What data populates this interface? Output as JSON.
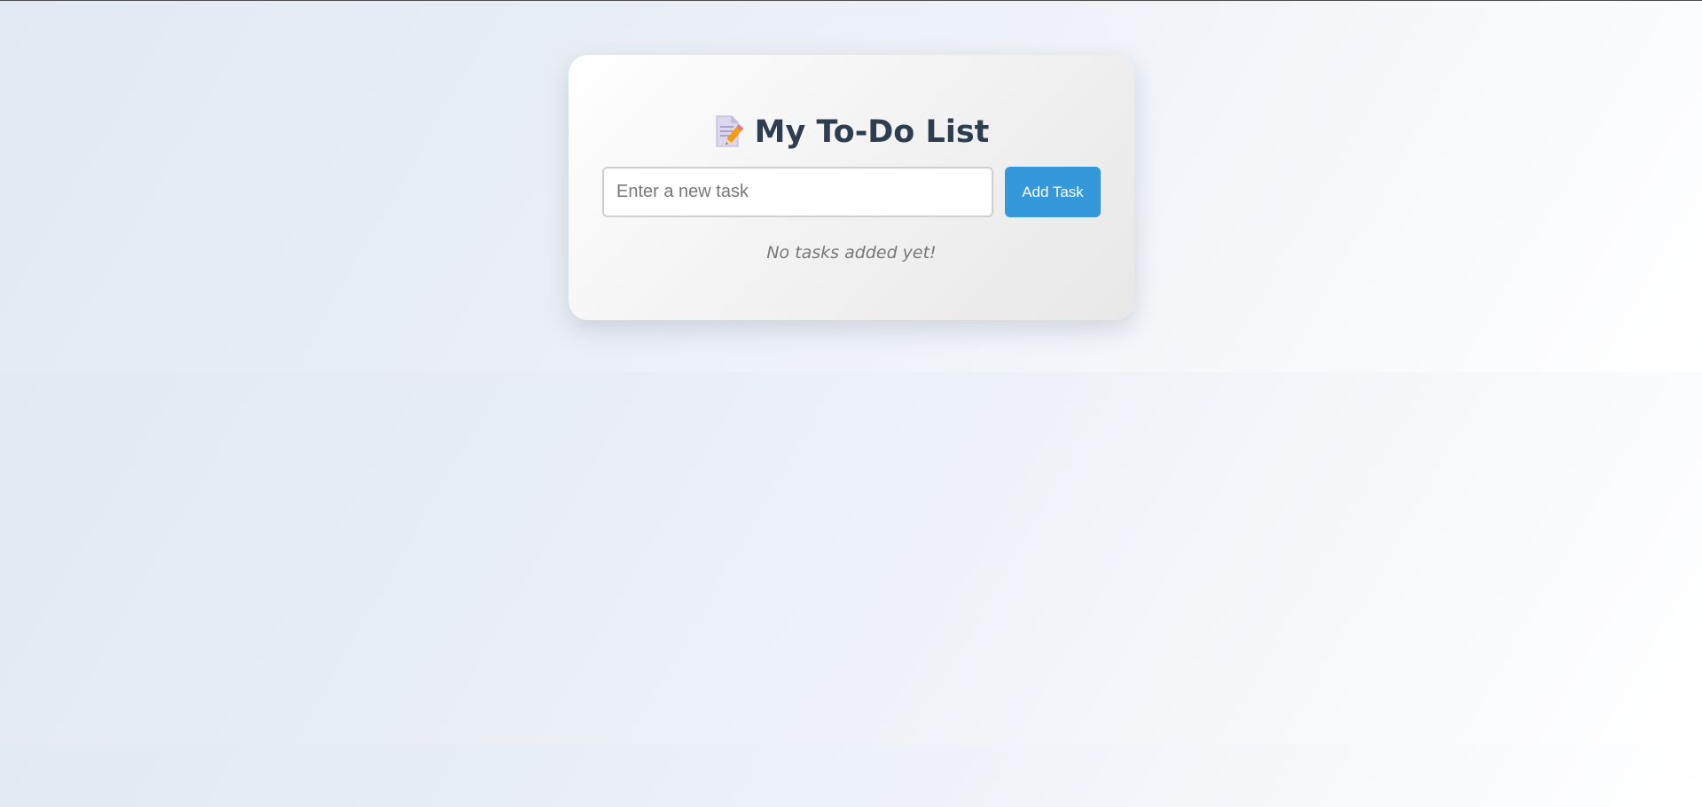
{
  "app": {
    "title": "My To-Do List",
    "title_icon": "memo-icon"
  },
  "task_form": {
    "input_value": "",
    "input_placeholder": "Enter a new task",
    "add_button_label": "Add Task"
  },
  "task_list": {
    "empty_message": "No tasks added yet!",
    "items": []
  },
  "colors": {
    "title_text": "#2c3e50",
    "button_bg": "#3498db",
    "button_text": "#ffffff",
    "muted_text": "#777777",
    "card_bg": "#f3f3f3",
    "page_bg": "#e6edf5"
  }
}
